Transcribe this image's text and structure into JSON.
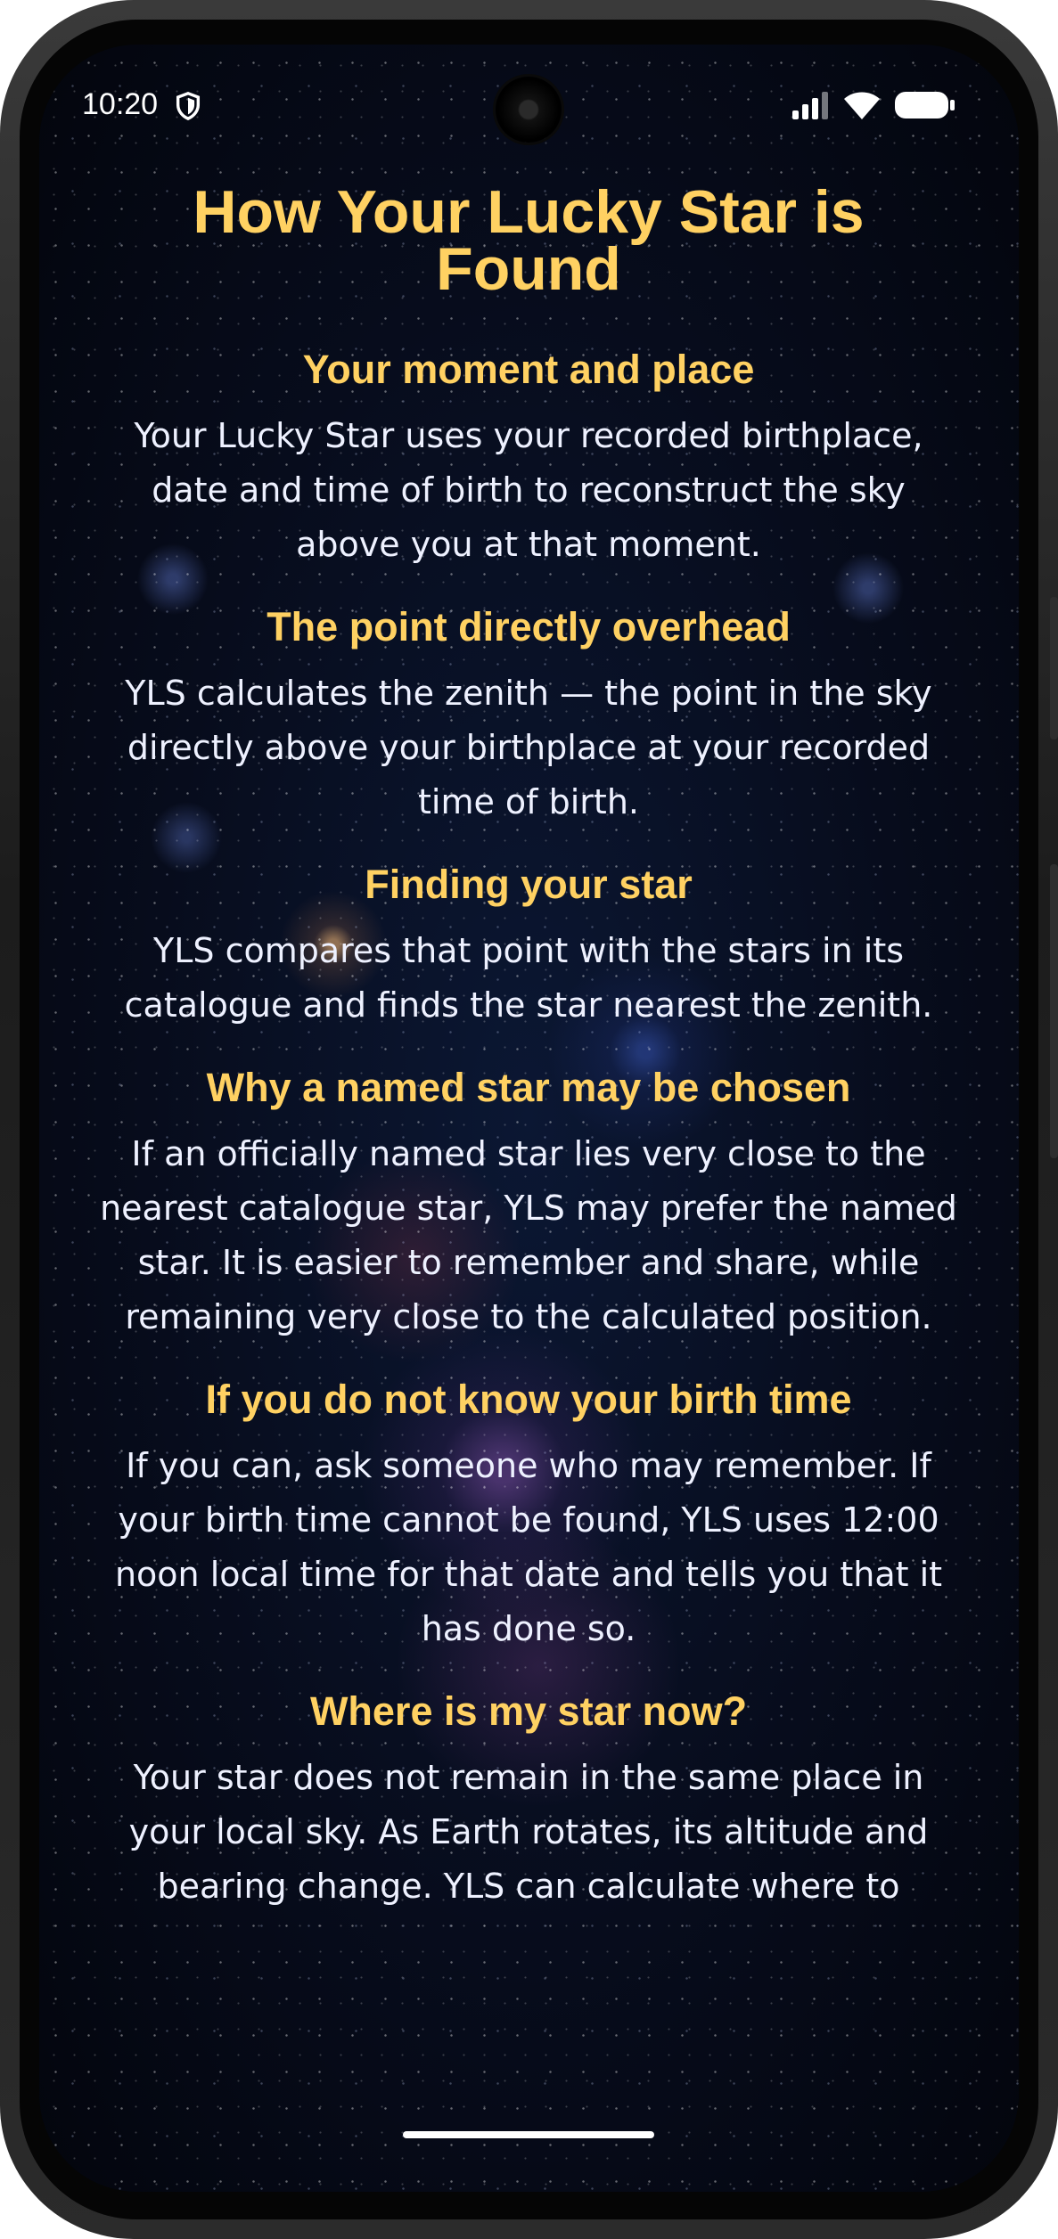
{
  "status_bar": {
    "time": "10:20",
    "icons": [
      "shield-icon",
      "signal-icon",
      "wifi-icon",
      "battery-icon"
    ]
  },
  "page": {
    "title": "How Your Lucky Star is Found",
    "sections": [
      {
        "heading": "Your moment and place",
        "body": "Your Lucky Star uses your recorded birthplace, date and time of birth to reconstruct the sky above you at that moment."
      },
      {
        "heading": "The point directly overhead",
        "body": "YLS calculates the zenith — the point in the sky directly above your birthplace at your recorded time of birth."
      },
      {
        "heading": "Finding your star",
        "body": "YLS compares that point with the stars in its catalogue and finds the star nearest the zenith."
      },
      {
        "heading": "Why a named star may be chosen",
        "body": "If an officially named star lies very close to the nearest catalogue star, YLS may prefer the named star. It is easier to remember and share, while remaining very close to the calculated position."
      },
      {
        "heading": "If you do not know your birth time",
        "body": "If you can, ask someone who may remember. If your birth time cannot be found, YLS uses 12:00 noon local time for that date and tells you that it has done so."
      },
      {
        "heading": "Where is my star now?",
        "body": "Your star does not remain in the same place in your local sky. As Earth rotates, its altitude and bearing change. YLS can calculate where to"
      }
    ]
  },
  "colors": {
    "heading": "#ffd162",
    "body_text": "#eef1ff",
    "background": "#070c1c"
  }
}
